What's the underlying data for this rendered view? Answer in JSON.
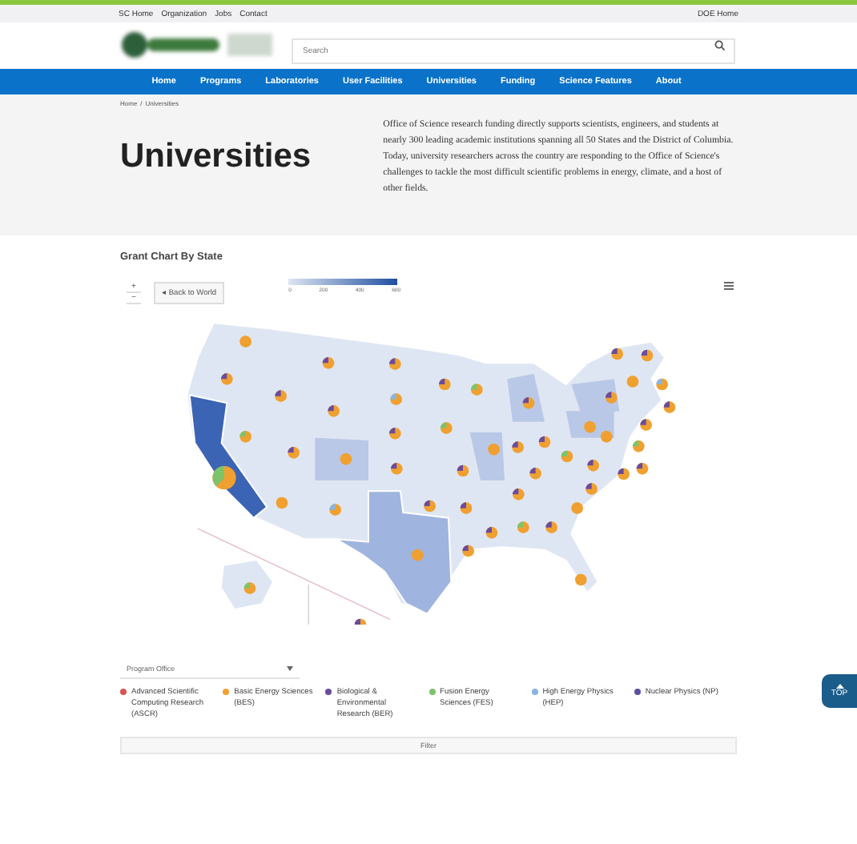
{
  "utility_links": [
    "SC Home",
    "Organization",
    "Jobs",
    "Contact"
  ],
  "utility_right": "DOE Home",
  "search": {
    "placeholder": "Search"
  },
  "nav": [
    "Home",
    "Programs",
    "Laboratories",
    "User Facilities",
    "Universities",
    "Funding",
    "Science Features",
    "About"
  ],
  "breadcrumb": {
    "items": [
      "Home",
      "Universities"
    ],
    "separator": "/"
  },
  "page_title": "Universities",
  "intro": "Office of Science research funding directly supports scientists, engineers, and students at nearly 300 leading academic institutions spanning all 50 States and the District of Columbia. Today, university researchers across the country are responding to the Office of Science's challenges to tackle the most difficult scientific problems in energy, climate, and a host of other fields.",
  "chart": {
    "title": "Grant Chart By State",
    "zoom_in": "+",
    "zoom_out": "−",
    "back_button": "◂ Back to World",
    "color_scale_ticks": [
      "0",
      "200",
      "400",
      "600"
    ]
  },
  "filter": {
    "dropdown": "Program Office",
    "legend": [
      {
        "label": "Advanced Scientific Computing Research (ASCR)",
        "color": "#d9534f"
      },
      {
        "label": "Basic Energy Sciences (BES)",
        "color": "#f0a030"
      },
      {
        "label": "Biological & Environmental Research (BER)",
        "color": "#6a4c9c"
      },
      {
        "label": "Fusion Energy Sciences (FES)",
        "color": "#7cc46a"
      },
      {
        "label": "High Energy Physics (HEP)",
        "color": "#8ab4e0"
      },
      {
        "label": "Nuclear Physics (NP)",
        "color": "#5a4fa0"
      }
    ],
    "button": "Filter"
  },
  "top_button": "TOP"
}
